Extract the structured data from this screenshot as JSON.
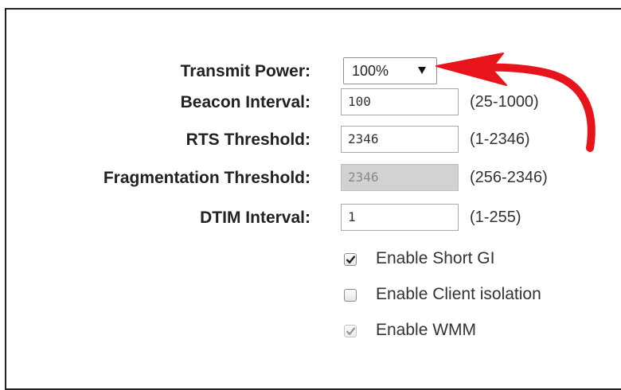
{
  "settings": {
    "transmit_power": {
      "label": "Transmit Power:",
      "value": "100%"
    },
    "beacon_interval": {
      "label": "Beacon Interval:",
      "value": "100",
      "range": "(25-1000)"
    },
    "rts_threshold": {
      "label": "RTS Threshold:",
      "value": "2346",
      "range": "(1-2346)"
    },
    "fragmentation_threshold": {
      "label": "Fragmentation Threshold:",
      "value": "2346",
      "range": "(256-2346)"
    },
    "dtim_interval": {
      "label": "DTIM Interval:",
      "value": "1",
      "range": "(1-255)"
    }
  },
  "options": {
    "short_gi": {
      "label": "Enable Short GI",
      "checked": true
    },
    "client_isolation": {
      "label": "Enable Client isolation",
      "checked": false
    },
    "wmm": {
      "label": "Enable WMM",
      "checked": true
    }
  },
  "colors": {
    "annotation_arrow": "#e8141b",
    "disabled_field": "#d2d2d2"
  }
}
